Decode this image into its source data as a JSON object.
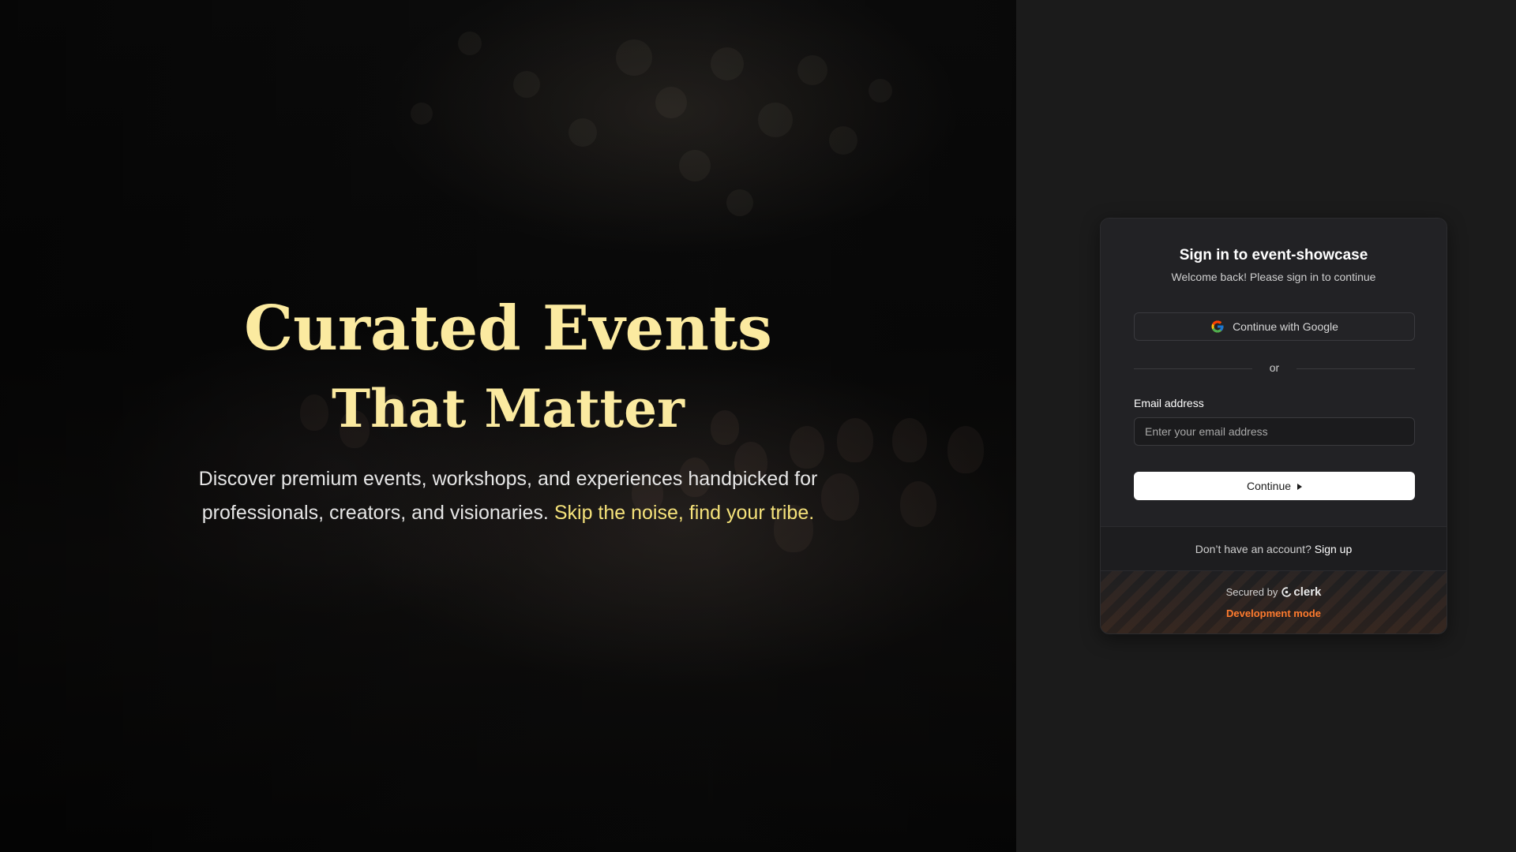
{
  "hero": {
    "title_line1": "Curated Events",
    "title_line2": "That Matter",
    "tagline_main": "Discover premium events, workshops, and experiences handpicked for professionals, creators, and visionaries.",
    "tagline_accent": "Skip the noise, find your tribe."
  },
  "auth": {
    "title": "Sign in to event-showcase",
    "subtitle": "Welcome back! Please sign in to continue",
    "google_button_label": "Continue with Google",
    "divider_text": "or",
    "email_label": "Email address",
    "email_placeholder": "Enter your email address",
    "email_value": "",
    "continue_label": "Continue",
    "footer_prompt": "Don’t have an account?",
    "signup_link": "Sign up",
    "secured_by": "Secured by",
    "brand": "clerk",
    "dev_mode": "Development mode"
  },
  "icons": {
    "google": "google-icon",
    "continue_arrow": "caret-right-icon",
    "brand_logo": "clerk-logo-icon"
  },
  "colors": {
    "hero_title": "#fbeaa0",
    "hero_accent": "#f5e27a",
    "dev_mode": "#ff7b2e",
    "primary_button_bg": "#ffffff"
  }
}
